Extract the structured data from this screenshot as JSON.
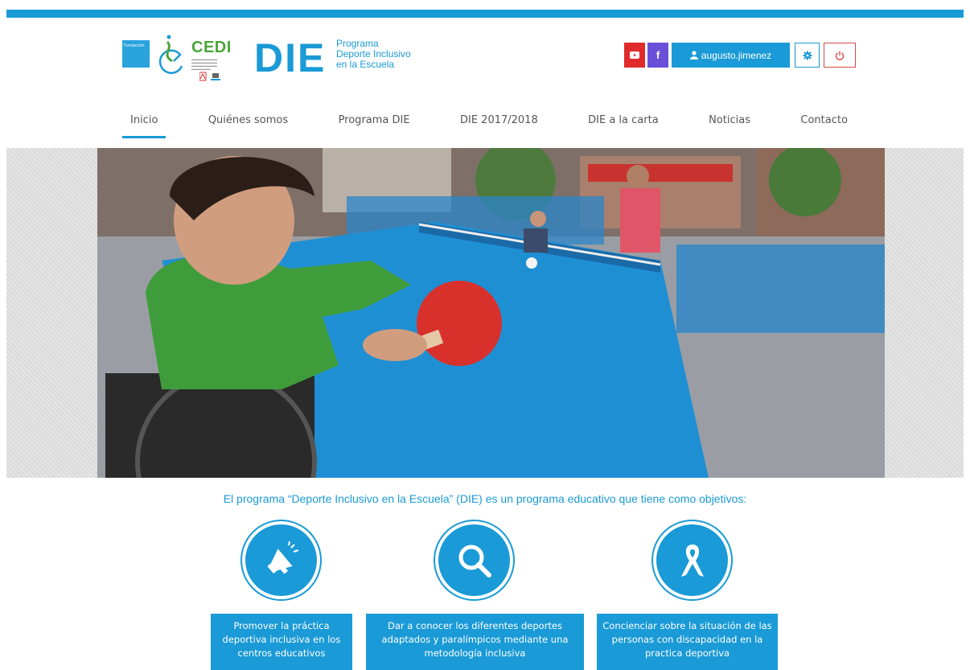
{
  "header": {
    "logo_fundacion": "Fundación",
    "logo_cedi": "CEDI",
    "logo_die": "DIE",
    "program_line1": "Programa",
    "program_line2": "Deporte Inclusivo",
    "program_line3": "en la Escuela",
    "username": "augusto.jimenez",
    "accent": "#1a9ad6"
  },
  "nav": {
    "items": [
      {
        "label": "Inicio"
      },
      {
        "label": "Quiénes somos"
      },
      {
        "label": "Programa DIE"
      },
      {
        "label": "DIE 2017/2018"
      },
      {
        "label": "DIE a la carta"
      },
      {
        "label": "Noticias"
      },
      {
        "label": "Contacto"
      }
    ]
  },
  "intro": "El programa “Deporte Inclusivo en la Escuela” (DIE) es un programa educativo que tiene como objetivos:",
  "objectives": [
    {
      "icon": "megaphone-icon",
      "text": "Promover la práctica deportiva inclusiva en los centros educativos"
    },
    {
      "icon": "magnifier-icon",
      "text": "Dar a conocer los diferentes deportes adaptados y paralímpicos mediante una metodología inclusiva"
    },
    {
      "icon": "ribbon-icon",
      "text": "Concienciar sobre la situación de las personas con discapacidad en la practica deportiva"
    }
  ]
}
